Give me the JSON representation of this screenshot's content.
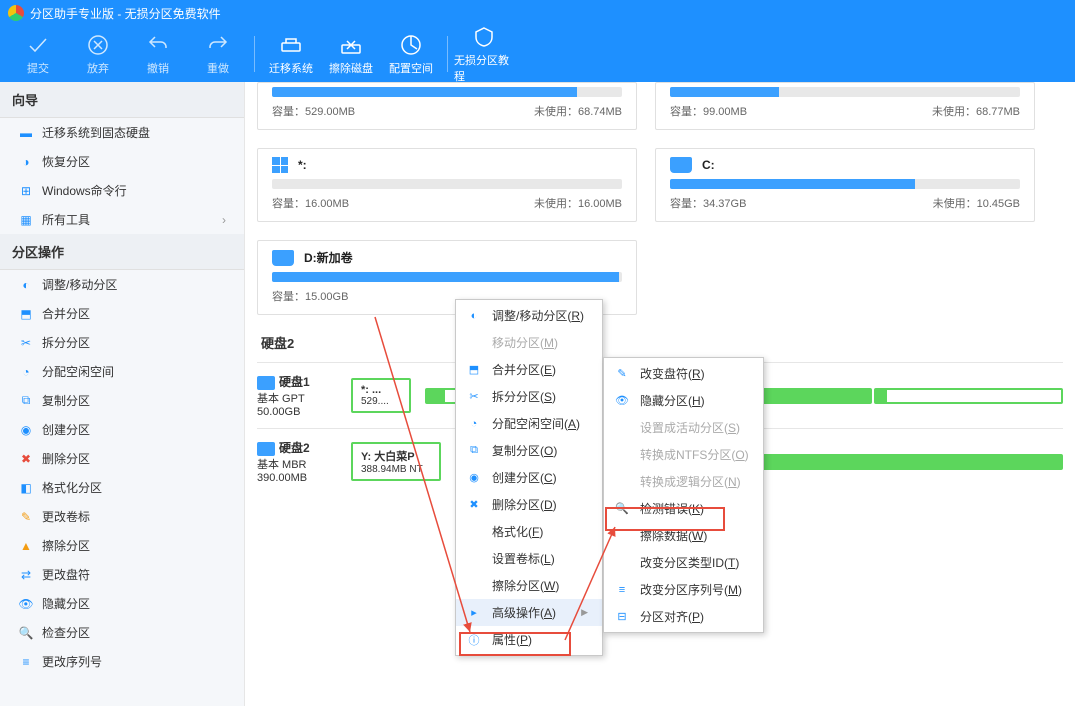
{
  "titlebar": {
    "title": "分区助手专业版 - 无损分区免费软件"
  },
  "toolbar": {
    "commit": "提交",
    "discard": "放弃",
    "undo": "撤销",
    "redo": "重做",
    "migrate": "迁移系统",
    "wipe": "擦除磁盘",
    "space": "配置空间",
    "tutorial": "无损分区教程"
  },
  "sidebar": {
    "wizard_header": "向导",
    "wizard": [
      {
        "label": "迁移系统到固态硬盘"
      },
      {
        "label": "恢复分区"
      },
      {
        "label": "Windows命令行"
      },
      {
        "label": "所有工具"
      }
    ],
    "ops_header": "分区操作",
    "ops": [
      {
        "label": "调整/移动分区"
      },
      {
        "label": "合并分区"
      },
      {
        "label": "拆分分区"
      },
      {
        "label": "分配空闲空间"
      },
      {
        "label": "复制分区"
      },
      {
        "label": "创建分区"
      },
      {
        "label": "删除分区"
      },
      {
        "label": "格式化分区"
      },
      {
        "label": "更改卷标"
      },
      {
        "label": "擦除分区"
      },
      {
        "label": "更改盘符"
      },
      {
        "label": "隐藏分区"
      },
      {
        "label": "检查分区"
      },
      {
        "label": "更改序列号"
      }
    ]
  },
  "cards": [
    {
      "name": "",
      "capacity_label": "容量：",
      "capacity": "529.00MB",
      "unused_label": "未使用：",
      "unused": "68.74MB",
      "fill_pct": 87
    },
    {
      "name": "",
      "capacity_label": "容量：",
      "capacity": "99.00MB",
      "unused_label": "未使用：",
      "unused": "68.77MB",
      "fill_pct": 31
    },
    {
      "name": "*:",
      "capacity_label": "容量：",
      "capacity": "16.00MB",
      "unused_label": "未使用：",
      "unused": "16.00MB",
      "fill_pct": 0,
      "is_win": true
    },
    {
      "name": "C:",
      "capacity_label": "容量：",
      "capacity": "34.37GB",
      "unused_label": "未使用：",
      "unused": "10.45GB",
      "fill_pct": 70
    },
    {
      "name": "D:新加卷",
      "capacity_label": "容量：",
      "capacity": "15.00GB",
      "unused_label": "未使用：",
      "unused": "",
      "fill_pct": 99
    }
  ],
  "disk2_title": "硬盘2",
  "disks": [
    {
      "dname": "硬盘1",
      "type": "基本 GPT",
      "size": "50.00GB",
      "p1_name": "*: ...",
      "p1_size": "529...."
    },
    {
      "dname": "硬盘2",
      "type": "基本 MBR",
      "size": "390.00MB",
      "p1_name": "Y: 大白菜P",
      "p1_size": "388.94MB NT"
    }
  ],
  "ctx1": [
    {
      "label": "调整/移动分区(R)",
      "key": "R"
    },
    {
      "label": "移动分区(M)",
      "key": "M",
      "disabled": true
    },
    {
      "label": "合并分区(E)",
      "key": "E"
    },
    {
      "label": "拆分分区(S)",
      "key": "S"
    },
    {
      "label": "分配空闲空间(A)",
      "key": "A"
    },
    {
      "label": "复制分区(O)",
      "key": "O"
    },
    {
      "label": "创建分区(C)",
      "key": "C"
    },
    {
      "label": "删除分区(D)",
      "key": "D"
    },
    {
      "label": "格式化(F)",
      "key": "F"
    },
    {
      "label": "设置卷标(L)",
      "key": "L"
    },
    {
      "label": "擦除分区(W)",
      "key": "W"
    },
    {
      "label": "高级操作(A)",
      "key": "A",
      "sub": true,
      "hl": true
    },
    {
      "label": "属性(P)",
      "key": "P"
    }
  ],
  "ctx2": [
    {
      "label": "改变盘符(R)",
      "key": "R"
    },
    {
      "label": "隐藏分区(H)",
      "key": "H"
    },
    {
      "label": "设置成活动分区(S)",
      "key": "S",
      "disabled": true
    },
    {
      "label": "转换成NTFS分区(O)",
      "key": "O",
      "disabled": true
    },
    {
      "label": "转换成逻辑分区(N)",
      "key": "N",
      "disabled": true
    },
    {
      "label": "检测错误(K)",
      "key": "K",
      "hl": true
    },
    {
      "label": "擦除数据(W)",
      "key": "W"
    },
    {
      "label": "改变分区类型ID(T)",
      "key": "T"
    },
    {
      "label": "改变分区序列号(M)",
      "key": "M"
    },
    {
      "label": "分区对齐(P)",
      "key": "P"
    }
  ]
}
